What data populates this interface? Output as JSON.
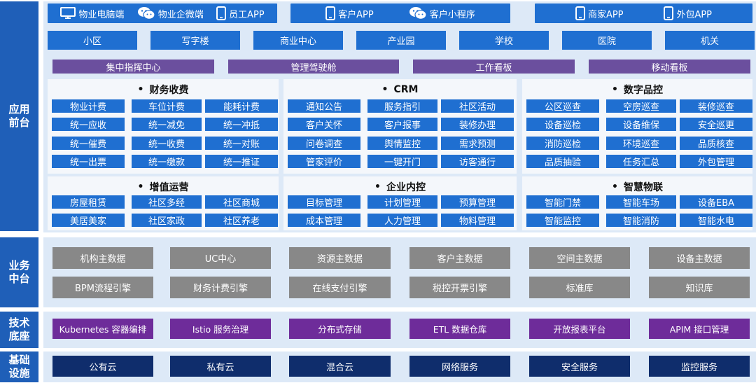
{
  "side_labels": {
    "app": "应用\n前台",
    "business": "业务\n中台",
    "tech": "技术\n底座",
    "infra": "基础\n设施"
  },
  "clients": [
    [
      {
        "icon": "monitor-icon",
        "label": "物业电脑端"
      },
      {
        "icon": "wechat-icon",
        "label": "物业企微端"
      },
      {
        "icon": "phone-icon",
        "label": "员工APP"
      }
    ],
    [
      {
        "icon": "phone-icon",
        "label": "客户APP"
      },
      {
        "icon": "wechat-icon",
        "label": "客户小程序"
      }
    ],
    [
      {
        "icon": "phone-icon",
        "label": "商家APP"
      },
      {
        "icon": "phone-icon",
        "label": "外包APP"
      }
    ]
  ],
  "scenarios": [
    "小区",
    "写字楼",
    "商业中心",
    "产业园",
    "学校",
    "医院",
    "机关"
  ],
  "command": [
    "集中指挥中心",
    "管理驾驶舱",
    "工作看板",
    "移动看板"
  ],
  "panels": [
    {
      "title": "财务收费",
      "items": [
        "物业计费",
        "车位计费",
        "能耗计费",
        "统一应收",
        "统一减免",
        "统一冲抵",
        "统一催费",
        "统一收费",
        "统一对账",
        "统一出票",
        "统一缴款",
        "统一推证"
      ]
    },
    {
      "title": "CRM",
      "items": [
        "通知公告",
        "服务指引",
        "社区活动",
        "客户关怀",
        "客户报事",
        "装修办理",
        "问卷调查",
        "舆情监控",
        "需求预测",
        "管家评价",
        "一键开门",
        "访客通行"
      ]
    },
    {
      "title": "数字品控",
      "items": [
        "公区巡查",
        "空房巡查",
        "装修巡查",
        "设备巡检",
        "设备维保",
        "安全巡更",
        "消防巡检",
        "环境巡查",
        "品质核查",
        "品质抽验",
        "任务汇总",
        "外包管理"
      ]
    },
    {
      "title": "增值运营",
      "items": [
        "房屋租赁",
        "社区多经",
        "社区商城",
        "美居美家",
        "社区家政",
        "社区养老"
      ]
    },
    {
      "title": "企业内控",
      "items": [
        "目标管理",
        "计划管理",
        "预算管理",
        "成本管理",
        "人力管理",
        "物料管理"
      ]
    },
    {
      "title": "智慧物联",
      "items": [
        "智能门禁",
        "智能车场",
        "设备EBA",
        "智能监控",
        "智能消防",
        "智能水电"
      ]
    }
  ],
  "business": [
    [
      "机构主数据",
      "UC中心",
      "资源主数据",
      "客户主数据",
      "空间主数据",
      "设备主数据"
    ],
    [
      "BPM流程引擎",
      "财务计费引擎",
      "在线支付引擎",
      "税控开票引擎",
      "标准库",
      "知识库"
    ]
  ],
  "tech": [
    "Kubernetes 容器编排",
    "Istio 服务治理",
    "分布式存储",
    "ETL 数据仓库",
    "开放报表平台",
    "APIM 接口管理"
  ],
  "infra": [
    "公有云",
    "私有云",
    "混合云",
    "网络服务",
    "安全服务",
    "监控服务"
  ]
}
